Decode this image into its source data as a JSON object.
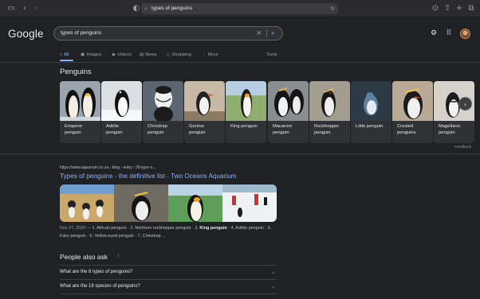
{
  "browser": {
    "address_text": "types of penguins"
  },
  "header": {
    "logo": "Google",
    "query": "types of penguins"
  },
  "tabs": [
    {
      "label": "All",
      "icon": "search-icon",
      "active": true
    },
    {
      "label": "Images",
      "icon": "image-icon"
    },
    {
      "label": "Videos",
      "icon": "video-icon"
    },
    {
      "label": "News",
      "icon": "news-icon"
    },
    {
      "label": "Shopping",
      "icon": "tag-icon"
    },
    {
      "label": "More",
      "icon": "more-icon"
    }
  ],
  "tools_label": "Tools",
  "carousel": {
    "title": "Penguins",
    "items": [
      {
        "l1": "Emperor",
        "l2": "penguin"
      },
      {
        "l1": "Adélie",
        "l2": "penguin"
      },
      {
        "l1": "Chinstrap",
        "l2": "penguin"
      },
      {
        "l1": "Gentoo",
        "l2": "penguin"
      },
      {
        "l1": "King penguin",
        "l2": ""
      },
      {
        "l1": "Macaroni",
        "l2": "penguin"
      },
      {
        "l1": "Rockhopper",
        "l2": "penguin"
      },
      {
        "l1": "Little penguin",
        "l2": ""
      },
      {
        "l1": "Crested",
        "l2": "penguins"
      },
      {
        "l1": "Magellanic",
        "l2": "penguin"
      }
    ],
    "feedback": "Feedback"
  },
  "result": {
    "cite": "https://www.aquarium.co.za › blog › entry › 26-type-o...",
    "title": "Types of penguins - the definitive list - Two Oceans Aquarium",
    "snippet_date": "Nov 27, 2020 —",
    "snippet_a": " 1. African penguin · 2. Northern rockhopper penguin · 3. ",
    "snippet_bold": "King penguin",
    "snippet_b": " · 4. Adélie penguin · 5. Fairy penguin · 6. Yellow-eyed penguin · 7. Chinstrap ..."
  },
  "paa": {
    "title": "People also ask",
    "questions": [
      "What are the 8 types of penguins?",
      "What are the 19 species of penguins?"
    ]
  },
  "colors": {
    "background": "#202124",
    "link": "#8ab4f8",
    "text": "#e8eaed",
    "muted": "#9aa0a6"
  }
}
